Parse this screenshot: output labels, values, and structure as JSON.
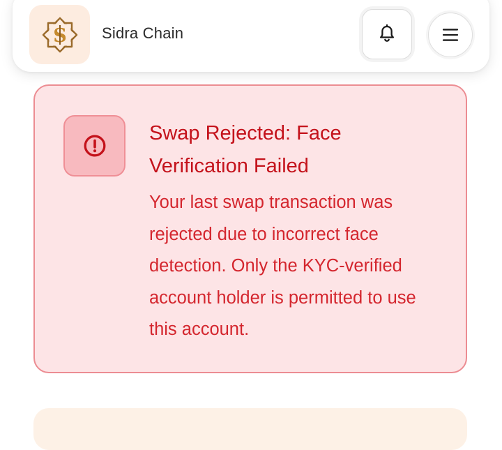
{
  "header": {
    "app_name": "Sidra Chain",
    "logo_letter": "S",
    "brand_color": "#c58a2e"
  },
  "icons": {
    "logo": "sidra-logo-icon",
    "notifications": "bell-icon",
    "menu": "hamburger-menu-icon",
    "alert": "exclamation-circle-icon"
  },
  "alert": {
    "title": "Swap Rejected: Face Verification Failed",
    "message": "Your last swap transaction was rejected due to incorrect face detection. Only the KYC-verified account holder is permitted to use this account.",
    "accent_color": "#c4121b",
    "background_color": "#fde4e6"
  }
}
